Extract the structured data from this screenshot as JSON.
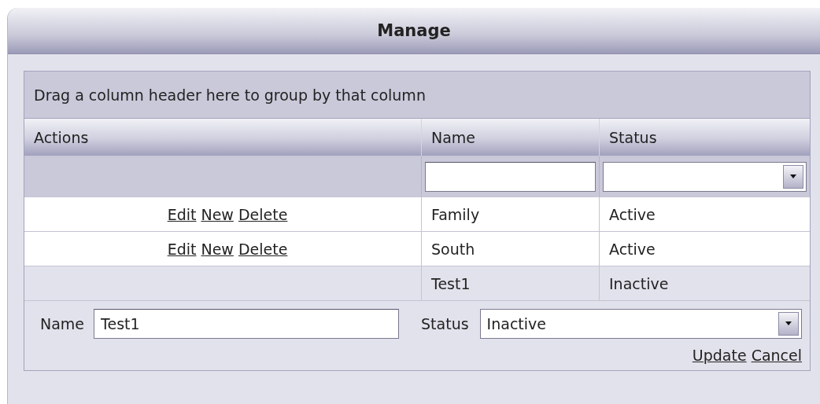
{
  "window": {
    "title": "Manage"
  },
  "group_panel": {
    "hint": "Drag a column header here to group by that column"
  },
  "columns": [
    "Actions",
    "Name",
    "Status"
  ],
  "rows": [
    {
      "actions": [
        "Edit",
        "New",
        "Delete"
      ],
      "name": "Family",
      "status": "Active",
      "editing": false
    },
    {
      "actions": [
        "Edit",
        "New",
        "Delete"
      ],
      "name": "South",
      "status": "Active",
      "editing": false
    },
    {
      "name": "Test1",
      "status": "Inactive",
      "editing": true
    }
  ],
  "edit_form": {
    "name_label": "Name",
    "name_value": "Test1",
    "status_label": "Status",
    "status_value": "Inactive",
    "links": [
      "Update",
      "Cancel"
    ]
  }
}
